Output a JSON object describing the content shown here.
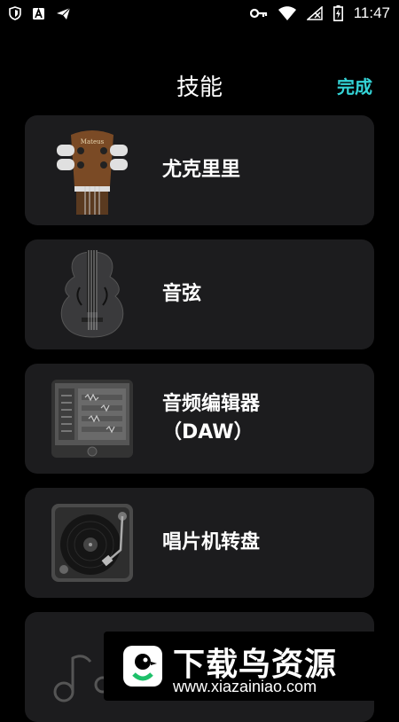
{
  "status_bar": {
    "time": "11:47",
    "left_icons": [
      "shield-icon",
      "font-a-icon",
      "send-icon"
    ],
    "right_icons": [
      "key-icon",
      "wifi-icon",
      "no-signal-icon",
      "battery-charging-icon"
    ]
  },
  "header": {
    "title": "技能",
    "done_label": "完成"
  },
  "cards": [
    {
      "label_line1": "尤克里里",
      "label_line2": "",
      "icon": "ukulele-icon"
    },
    {
      "label_line1": "音弦",
      "label_line2": "",
      "icon": "violin-icon"
    },
    {
      "label_line1": "音频编辑器",
      "label_line2": "（DAW）",
      "icon": "daw-icon"
    },
    {
      "label_line1": "唱片机转盘",
      "label_line2": "",
      "icon": "turntable-icon"
    },
    {
      "label_line1": "",
      "label_line2": "",
      "icon": "music-note-icon"
    }
  ],
  "watermark": {
    "title": "下载鸟资源",
    "url": "www.xiazainiao.com"
  },
  "colors": {
    "accent": "#34d3d6",
    "card_bg": "#1c1c1e",
    "background": "#000000"
  }
}
